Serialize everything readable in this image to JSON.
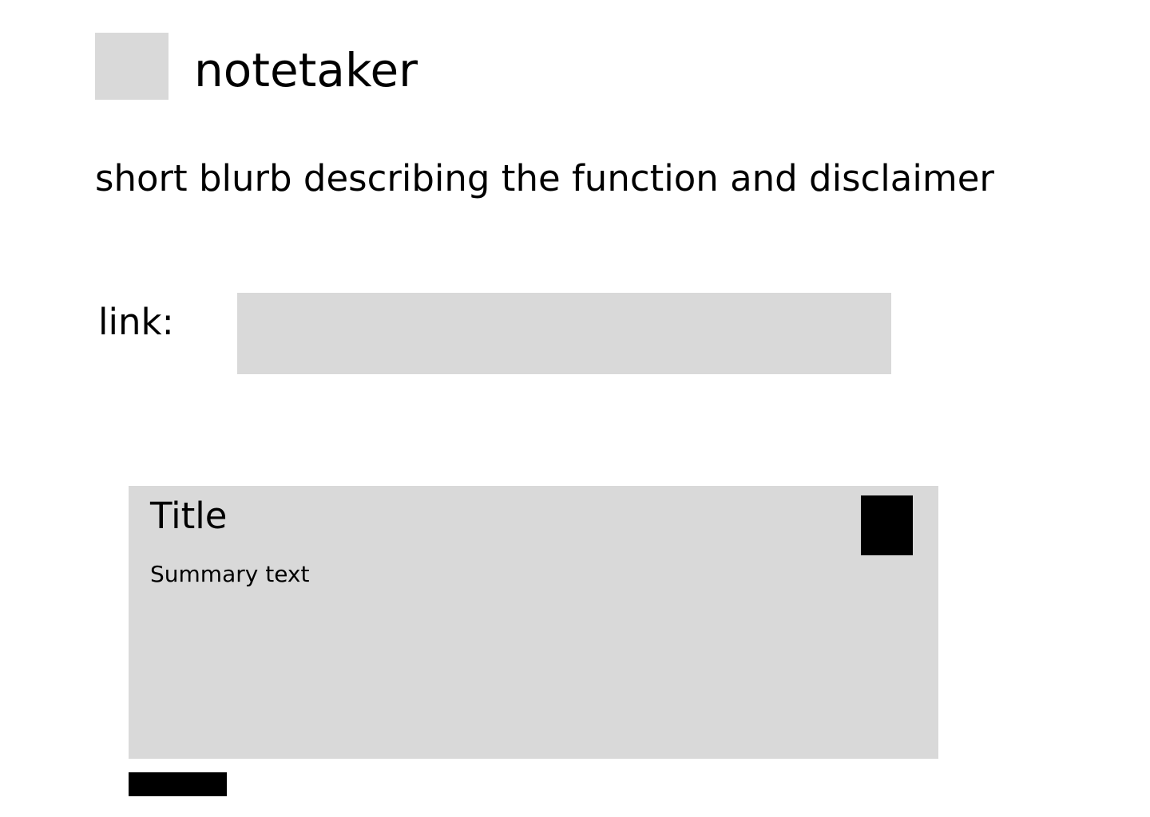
{
  "header": {
    "app_title": "notetaker"
  },
  "intro": {
    "blurb": "short blurb describing the function and disclaimer"
  },
  "link_form": {
    "label": "link:",
    "value": "",
    "placeholder": ""
  },
  "note_card": {
    "title": "Title",
    "summary": "Summary text"
  },
  "colors": {
    "background": "#ffffff",
    "placeholder_gray": "#d9d9d9",
    "action_black": "#000000"
  }
}
